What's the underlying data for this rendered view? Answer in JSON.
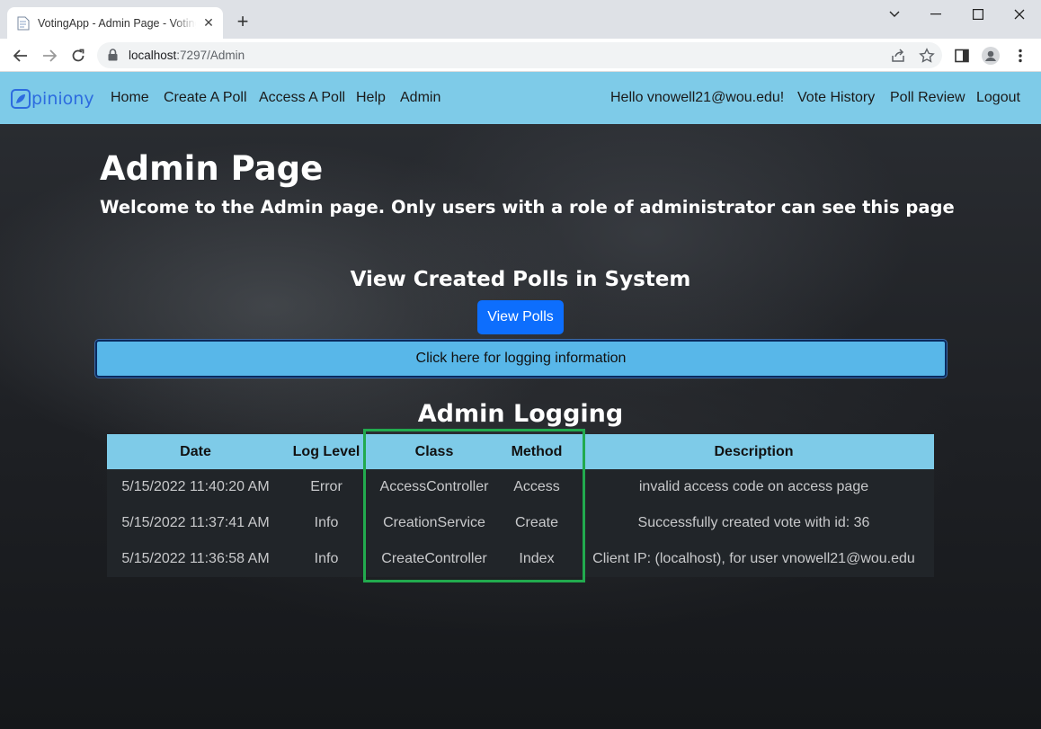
{
  "browser": {
    "tab_title": "VotingApp - Admin Page - Voting",
    "url_host": "localhost",
    "url_port_path": ":7297/Admin"
  },
  "navbar": {
    "brand": "piniony",
    "links": [
      "Home",
      "Create A Poll",
      "Access A Poll",
      "Help",
      "Admin"
    ],
    "greeting": "Hello vnowell21@wou.edu!",
    "right_links": [
      "Vote History",
      "Poll Review",
      "Logout"
    ]
  },
  "main": {
    "title": "Admin Page",
    "lead": "Welcome to the Admin page. Only users with a role of administrator can see this page",
    "polls_heading": "View Created Polls in System",
    "view_polls_label": "View Polls",
    "logging_button_label": "Click here for logging information",
    "logging_heading": "Admin Logging"
  },
  "log_table": {
    "headers": [
      "Date",
      "Log Level",
      "Class",
      "Method",
      "Description"
    ],
    "rows": [
      [
        "5/15/2022 11:40:20 AM",
        "Error",
        "AccessController",
        "Access",
        "invalid access code on access page"
      ],
      [
        "5/15/2022 11:37:41 AM",
        "Info",
        "CreationService",
        "Create",
        "Successfully created vote with id: 36"
      ],
      [
        "5/15/2022 11:36:58 AM",
        "Info",
        "CreateController",
        "Index",
        "Client IP: (localhost), for user vnowell21@wou.edu"
      ]
    ]
  },
  "colors": {
    "navbar": "#7ecbe8",
    "primary_button": "#0d6efd",
    "highlight_box": "#22aa4e"
  }
}
